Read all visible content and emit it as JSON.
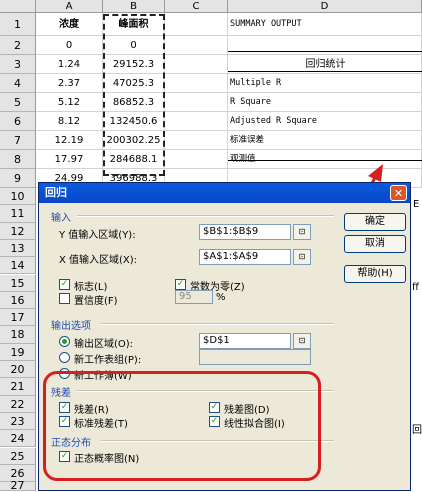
{
  "sheet": {
    "columns": [
      "A",
      "B",
      "C",
      "D"
    ],
    "rows": [
      "1",
      "2",
      "3",
      "4",
      "5",
      "6",
      "7",
      "8",
      "9",
      "10",
      "11",
      "12",
      "13",
      "14",
      "15",
      "16",
      "17",
      "18",
      "19",
      "20",
      "21",
      "22",
      "23",
      "24",
      "25",
      "26",
      "27"
    ],
    "colA": [
      "浓度",
      "0",
      "1.24",
      "2.37",
      "5.12",
      "8.12",
      "12.19",
      "17.97",
      "24.99"
    ],
    "colB": [
      "峰面积",
      "0",
      "29152.3",
      "47025.3",
      "86852.3",
      "132450.6",
      "200302.25",
      "284688.1",
      "396988.3"
    ],
    "colD": [
      "SUMMARY OUTPUT",
      "",
      "回归统计",
      "Multiple R",
      "R Square",
      "Adjusted R Square",
      "标准误差",
      "观测值"
    ],
    "edge_fragments": {
      "row11": "E",
      "row16": "ff",
      "row24": "回"
    }
  },
  "dialog": {
    "title": "回归",
    "close_glyph": "✕",
    "input_group": "输入",
    "y_label": "Y 值输入区域(Y):",
    "y_value": "$B$1:$B$9",
    "x_label": "X 值输入区域(X):",
    "x_value": "$A$1:$A$9",
    "labels_check": "标志(L)",
    "const_zero_check": "常数为零(Z)",
    "confidence_check": "置信度(F)",
    "confidence_value": "95",
    "percent": "%",
    "output_group": "输出选项",
    "output_range_radio": "输出区域(O):",
    "output_range_value": "$D$1",
    "new_sheet_radio": "新工作表组(P):",
    "new_book_radio": "新工作簿(W)",
    "residual_group": "残差",
    "residuals_check": "残差(R)",
    "residual_plot_check": "残差图(D)",
    "std_residuals_check": "标准残差(T)",
    "line_fit_check": "线性拟合图(I)",
    "normal_group": "正态分布",
    "normal_plot_check": "正态概率图(N)",
    "ok_button": "确定",
    "cancel_button": "取消",
    "help_button": "帮助(H)",
    "ref_icon_glyph": "⊡"
  },
  "colors": {
    "annotation_red": "#d62020",
    "check_green": "#21a121",
    "titlebar_blue": "#0a5be0"
  }
}
